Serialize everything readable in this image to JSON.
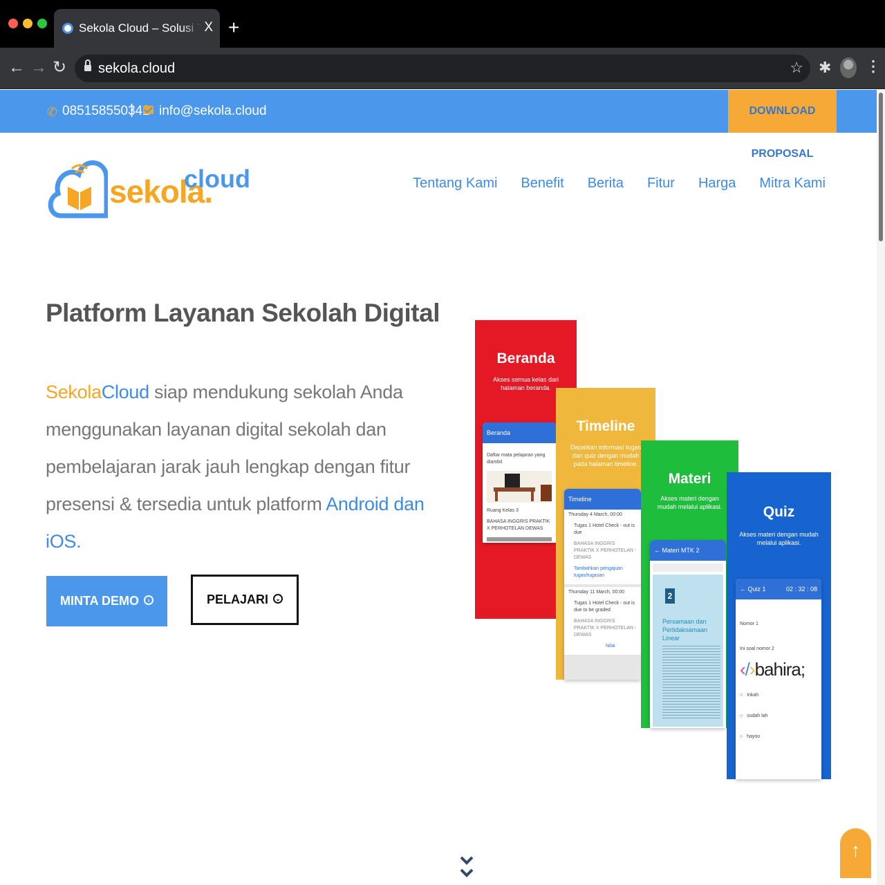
{
  "browser": {
    "tab_title": "Sekola Cloud – Solusi Terbaik Layanan Sekolah Digital",
    "tab_close": "X",
    "new_tab": "+",
    "url": "sekola.cloud"
  },
  "topbar": {
    "phone": "085158550342",
    "separator": "|",
    "email": "info@sekola.cloud",
    "download_label": "DOWNLOAD PROPOSAL"
  },
  "logo": {
    "main": "sekola",
    "dot": ".",
    "sup": "cloud"
  },
  "nav": [
    "Tentang Kami",
    "Benefit",
    "Berita",
    "Fitur",
    "Harga",
    "Mitra Kami"
  ],
  "hero": {
    "title": "Platform Layanan Sekolah Digital",
    "brand_a": "Sekola",
    "brand_b": "Cloud",
    "text_1": " siap mendukung sekolah Anda menggunakan layanan digital sekolah dan pembelajaran jarak jauh lengkap dengan fitur presensi & tersedia untuk platform ",
    "platforms": "Android dan iOS",
    "period": ".",
    "demo_button": "MINTA DEMO",
    "learn_button": "PELAJARI"
  },
  "phones": {
    "beranda": {
      "title": "Beranda",
      "sub": "Akses semua kelas dari halaman beranda.",
      "header": "Beranda",
      "list_title": "Daftar mata pelajaran yang diambil",
      "room": "Ruang Kelas 3",
      "course": "BAHASA INGGRIS PRAKTIK X PERHOTELAN DEWAS"
    },
    "timeline": {
      "title": "Timeline",
      "sub": "Dapatkan informasi tugas dan quiz dengan mudah pada halaman timeline.",
      "header": "Timeline",
      "date_1": "Thursday 4 March, 00:00",
      "task_1": "Tugas 1 Hotel Check - out is due",
      "course_1": "BAHASA INGGRIS PRAKTIK X PERHOTELAN - DEWAS",
      "link_1": "Tambahkan pengajuan tugas/tugasan",
      "date_2": "Thursday 11 March, 00:00",
      "task_2": "Tugas 1 Hotel Check - out is due to be graded",
      "course_2": "BAHASA INGGRIS PRAKTIK X PERHOTELAN - DEWAS",
      "link_2": "Nilai"
    },
    "materi": {
      "title": "Materi",
      "sub": "Akses materi dengan mudah melalui aplikasi.",
      "header": "Materi MTK 2",
      "chapter": "2",
      "chapter_title": "Persamaan dan Pertidaksamaan Linear"
    },
    "quiz": {
      "title": "Quiz",
      "sub": "Akses materi dengan mudah melalui aplikasi.",
      "header": "Quiz 1",
      "timer": "02 : 32 : 08",
      "nomor": "Nomor 1",
      "question": "Ini soal nomor 2",
      "bahira": "bahira;",
      "options": [
        "Inkah",
        "sudah lah",
        "hayoo"
      ]
    }
  },
  "colors": {
    "accent_blue": "#4a97ec",
    "accent_orange": "#f6a937",
    "beranda": "#e51926",
    "timeline": "#f0b73d",
    "materi": "#1ebd3c",
    "quiz": "#1764d1"
  },
  "icons": [
    "back-icon",
    "forward-icon",
    "reload-icon",
    "lock-icon",
    "star-icon",
    "extensions-icon",
    "profile-avatar",
    "menu-icon",
    "phone-icon",
    "mail-icon",
    "arrow-circle-right-icon",
    "arrow-circle-down-icon",
    "chevrons-down-icon",
    "arrow-up-icon"
  ]
}
